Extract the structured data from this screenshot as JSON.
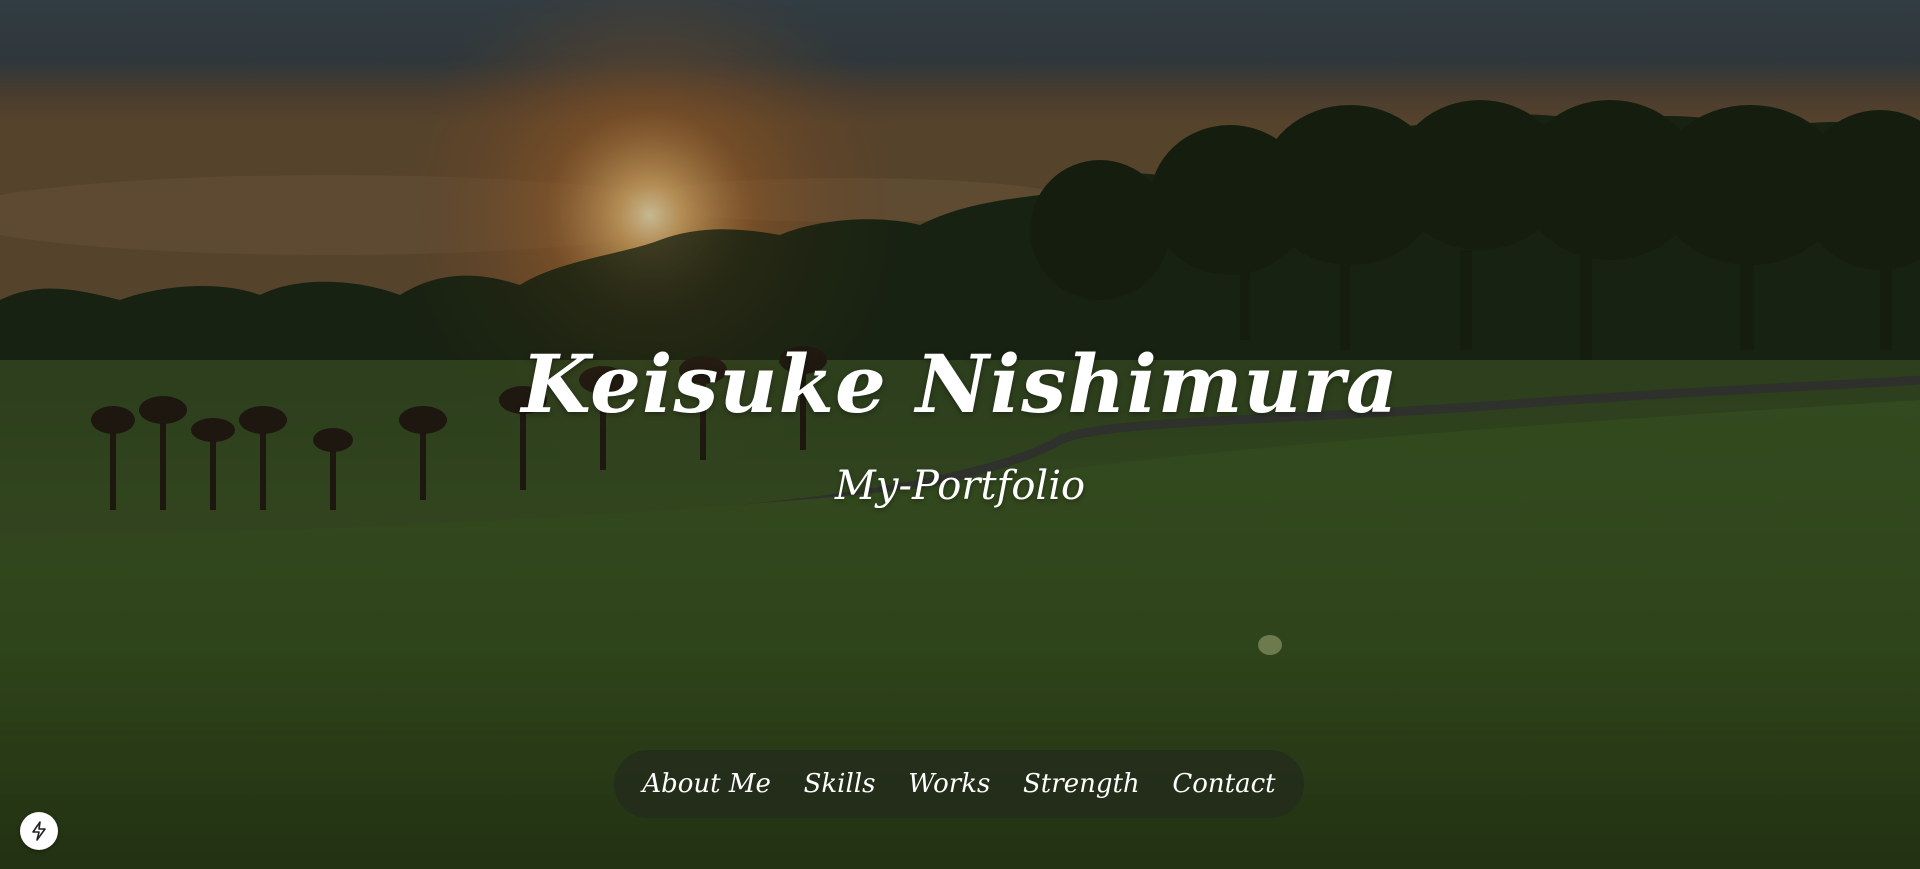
{
  "hero": {
    "title": "Keisuke Nishimura",
    "subtitle": "My-Portfolio"
  },
  "nav": {
    "items": [
      {
        "label": "About Me"
      },
      {
        "label": "Skills"
      },
      {
        "label": "Works"
      },
      {
        "label": "Strength"
      },
      {
        "label": "Contact"
      }
    ]
  },
  "floating_button": {
    "icon": "bolt-icon"
  },
  "colors": {
    "text": "#ffffff",
    "nav_background": "#222a1c",
    "sky_top": "#3a4a52",
    "grass": "#3e5a22"
  }
}
